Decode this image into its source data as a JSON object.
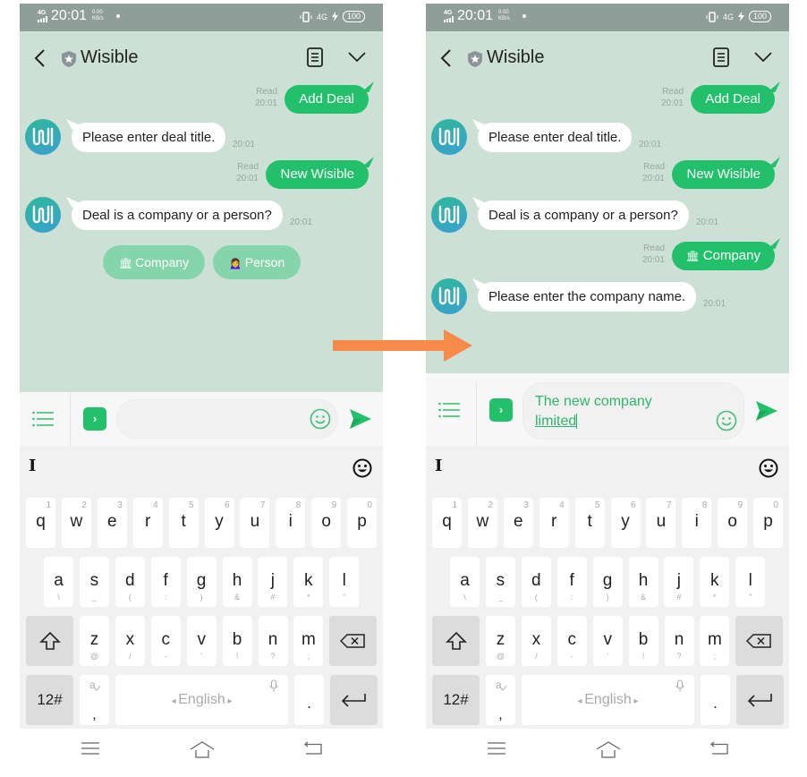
{
  "status_bar": {
    "network": "4G",
    "time": "20:01",
    "speed_value": "0.00",
    "speed_unit": "KB/s",
    "network_right": "4G",
    "battery": "100"
  },
  "app_bar": {
    "title": "Wisible",
    "back_icon": "chevron-left-icon",
    "badge_icon": "shield-star-icon",
    "doc_icon": "document-icon",
    "expand_icon": "chevron-down-icon"
  },
  "colors": {
    "chat_background": "#cce0d6",
    "outgoing_bubble": "#22c06a",
    "incoming_bubble": "#ffffff",
    "quick_reply": "#86d4ab",
    "status_bar": "#8f9e98",
    "flow_arrow": "#f68a4a",
    "input_text": "#2fb56a"
  },
  "screens": [
    {
      "messages": [
        {
          "from": "user",
          "text": "Add Deal",
          "status": "Read",
          "time": "20:01"
        },
        {
          "from": "bot",
          "text": "Please enter deal title.",
          "time": "20:01"
        },
        {
          "from": "user",
          "text": "New Wisible",
          "status": "Read",
          "time": "20:01"
        },
        {
          "from": "bot",
          "text": "Deal is a company or a person?",
          "time": "20:01"
        }
      ],
      "quick_replies": [
        {
          "emoji": "🏛",
          "label": "Company"
        },
        {
          "emoji": "🙍‍♀️",
          "label": "Person"
        }
      ],
      "input": {
        "value": "",
        "value_line2": ""
      }
    },
    {
      "messages": [
        {
          "from": "user",
          "text": "Add Deal",
          "status": "Read",
          "time": "20:01"
        },
        {
          "from": "bot",
          "text": "Please enter deal title.",
          "time": "20:01"
        },
        {
          "from": "user",
          "text": "New Wisible",
          "status": "Read",
          "time": "20:01"
        },
        {
          "from": "bot",
          "text": "Deal is a company or a person?",
          "time": "20:01"
        },
        {
          "from": "user",
          "emoji": "🏛",
          "text": "Company",
          "status": "Read",
          "time": "20:01"
        },
        {
          "from": "bot",
          "text": "Please enter the company name.",
          "time": "20:01"
        }
      ],
      "input": {
        "value": "The new company",
        "value_line2": "limited"
      }
    }
  ],
  "composer": {
    "menu_icon": "list-icon",
    "toggle_icon": "chevron-right-square-icon",
    "emoji_icon": "smiley-icon",
    "send_icon": "send-icon"
  },
  "keyboard": {
    "row1": [
      {
        "key": "q",
        "alt": "1"
      },
      {
        "key": "w",
        "alt": "2"
      },
      {
        "key": "e",
        "alt": "3"
      },
      {
        "key": "r",
        "alt": "4"
      },
      {
        "key": "t",
        "alt": "5"
      },
      {
        "key": "y",
        "alt": "6"
      },
      {
        "key": "u",
        "alt": "7"
      },
      {
        "key": "i",
        "alt": "8"
      },
      {
        "key": "o",
        "alt": "9"
      },
      {
        "key": "p",
        "alt": "0"
      }
    ],
    "row2": [
      {
        "key": "a",
        "alt": "\\"
      },
      {
        "key": "s",
        "alt": "_"
      },
      {
        "key": "d",
        "alt": "("
      },
      {
        "key": "f",
        "alt": ":"
      },
      {
        "key": "g",
        "alt": ")"
      },
      {
        "key": "h",
        "alt": "&"
      },
      {
        "key": "j",
        "alt": "#"
      },
      {
        "key": "k",
        "alt": "*"
      },
      {
        "key": "l",
        "alt": "\""
      }
    ],
    "row3": [
      {
        "key": "z",
        "alt": "@"
      },
      {
        "key": "x",
        "alt": "/"
      },
      {
        "key": "c",
        "alt": "-"
      },
      {
        "key": "v",
        "alt": "'"
      },
      {
        "key": "b",
        "alt": "!"
      },
      {
        "key": "n",
        "alt": "?"
      },
      {
        "key": "m",
        "alt": ";"
      }
    ],
    "symbols_label": "12#",
    "comma_label": ",",
    "space_label": "English",
    "period_label": ".",
    "cursor_glyph": "I"
  },
  "nav_bar": {
    "items": [
      "menu-icon",
      "home-icon",
      "back-icon"
    ]
  }
}
